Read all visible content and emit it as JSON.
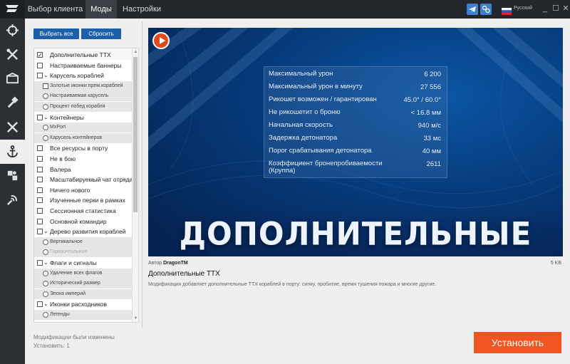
{
  "titlebar": {
    "tabs": [
      {
        "label": "Выбор клиента",
        "active": false
      },
      {
        "label": "Моды",
        "active": true
      },
      {
        "label": "Настройки",
        "active": false
      }
    ],
    "language": "Русский"
  },
  "sidebar": {
    "icons": [
      "crosshair-icon",
      "tools-icon",
      "hangar-icon",
      "hammer-icon",
      "swords-icon",
      "anchor-icon",
      "puzzle-icon",
      "signal-icon"
    ],
    "active_index": 5
  },
  "list": {
    "select_all_label": "Выбрать все",
    "reset_label": "Сбросить",
    "items": [
      {
        "kind": "checkbox",
        "label": "Дополнительные ТТХ",
        "checked": true,
        "selected": true
      },
      {
        "kind": "checkbox",
        "label": "Настраиваемые баннеры",
        "checked": false
      },
      {
        "kind": "group",
        "label": "Карусель кораблей"
      },
      {
        "kind": "sub-checkbox",
        "label": "Золотые иконки прем.кораблей"
      },
      {
        "kind": "sub-radio",
        "label": "Настраиваемая карусель"
      },
      {
        "kind": "sub-radio",
        "label": "Процент побед корабля"
      },
      {
        "kind": "group",
        "label": "Контейнеры"
      },
      {
        "kind": "sub-radio",
        "label": "MxPort"
      },
      {
        "kind": "sub-radio",
        "label": "Карусель контейнеров"
      },
      {
        "kind": "checkbox",
        "label": "Все ресурсы в порту",
        "checked": false
      },
      {
        "kind": "checkbox",
        "label": "Не в бою",
        "checked": false
      },
      {
        "kind": "checkbox",
        "label": "Валера",
        "checked": false
      },
      {
        "kind": "checkbox",
        "label": "Масштабируемый чат отряда",
        "checked": false
      },
      {
        "kind": "checkbox",
        "label": "Ничего нового",
        "checked": false
      },
      {
        "kind": "checkbox",
        "label": "Изученные перки в рамках",
        "checked": false
      },
      {
        "kind": "checkbox",
        "label": "Сессионная статистика",
        "checked": false
      },
      {
        "kind": "checkbox",
        "label": "Основной командир",
        "checked": false
      },
      {
        "kind": "group",
        "label": "Дерево развития кораблей"
      },
      {
        "kind": "sub-radio",
        "label": "Вертикальное"
      },
      {
        "kind": "sub-radio-disabled",
        "label": "Горизонтальное"
      },
      {
        "kind": "group",
        "label": "Флаги и сигналы"
      },
      {
        "kind": "sub-radio",
        "label": "Удаление всех флагов"
      },
      {
        "kind": "sub-radio",
        "label": "Исторический размер"
      },
      {
        "kind": "sub-radio",
        "label": "Эпоха империй"
      },
      {
        "kind": "group",
        "label": "Иконки расходников"
      },
      {
        "kind": "sub-radio",
        "label": "Легенды"
      }
    ]
  },
  "preview": {
    "stats": [
      {
        "name": "Максимальный урон",
        "value": "6 200"
      },
      {
        "name": "Максимальный урон в минуту",
        "value": "27 556"
      },
      {
        "name": "Рикошет возможен / гарантирован",
        "value": "45.0° / 60.0°"
      },
      {
        "name": "Не рикошетит о броню",
        "value": "< 16.8 мм"
      },
      {
        "name": "Начальная скорость",
        "value": "940 м/с"
      },
      {
        "name": "Задержка детонатора",
        "value": "33 мс"
      },
      {
        "name": "Порог срабатывания детонатора",
        "value": "40 мм"
      },
      {
        "name": "Коэффициент бронепробиваемости (Круппа)",
        "value": "2611"
      }
    ],
    "banner_title": "ДОПОЛНИТЕЛЬНЫЕ ТТХ"
  },
  "details": {
    "author_label": "Автор",
    "author_name": "DragonTM",
    "size": "5 KB",
    "title": "Дополнительные ТТХ",
    "description": "Модификация добавляет дополнительные ТТХ кораблей в порту: сигму, пробитие, время тушения пожара и многие другие."
  },
  "footer": {
    "status_line1": "Модификации были изменены",
    "status_line2": "Установить: 1",
    "install_label": "Установить"
  },
  "colors": {
    "accent": "#1d5fa8",
    "install": "#f25421",
    "sidebar": "#2c3035"
  }
}
